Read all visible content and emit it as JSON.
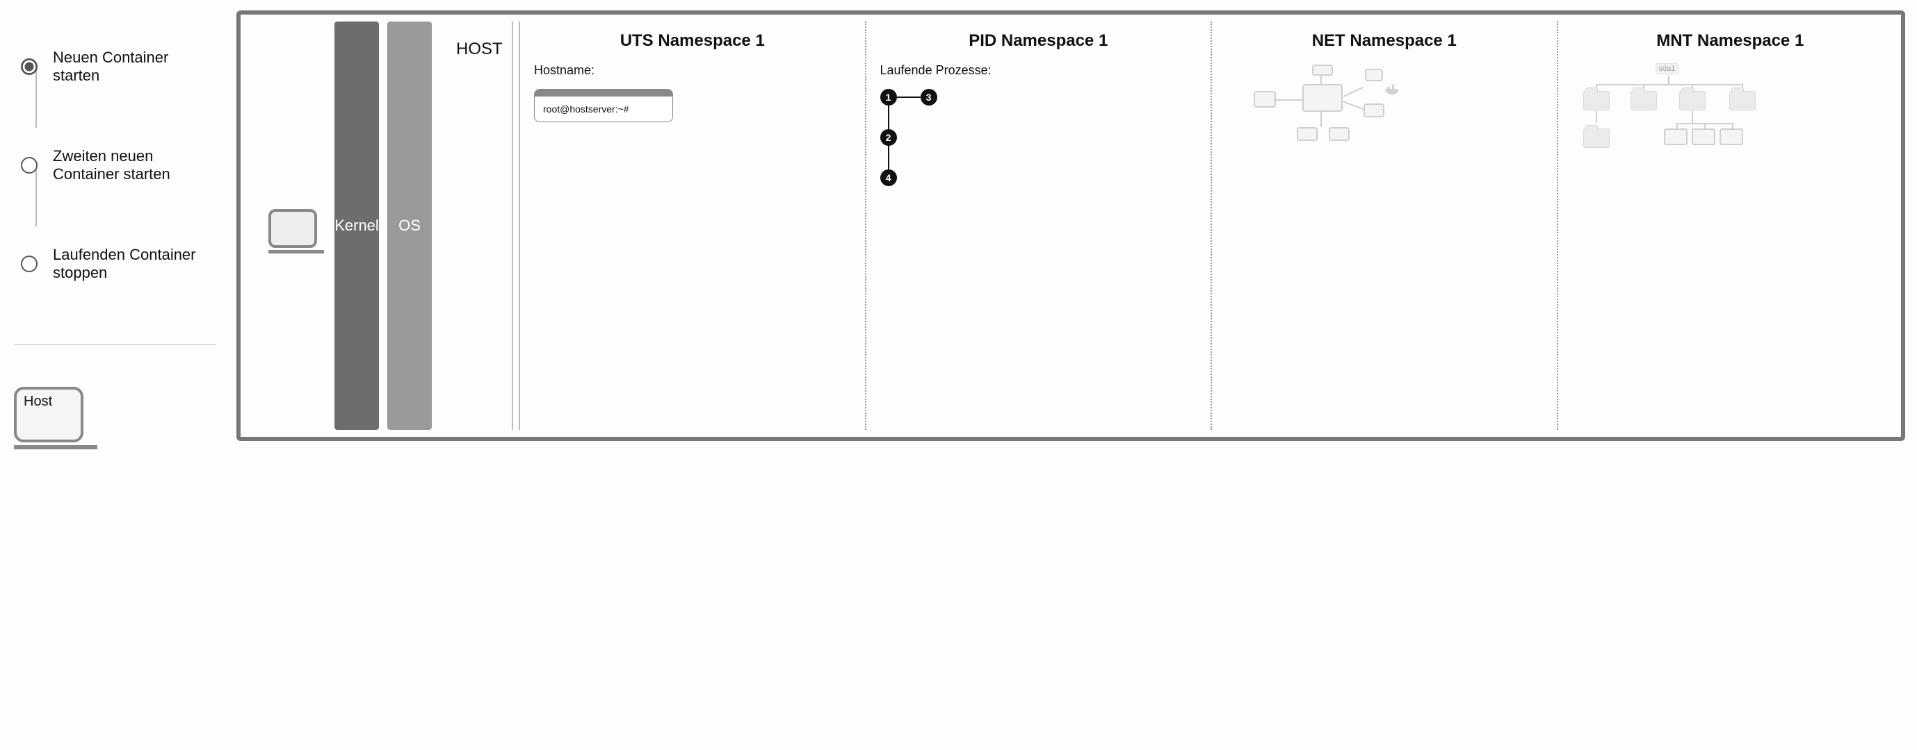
{
  "sidebar": {
    "steps": [
      {
        "label": "Neuen Container starten",
        "active": true
      },
      {
        "label": "Zweiten neuen Container starten",
        "active": false
      },
      {
        "label": "Laufenden Container stoppen",
        "active": false
      }
    ],
    "host_legend_label": "Host"
  },
  "main": {
    "host": {
      "title": "HOST",
      "kernel_label": "Kernel",
      "os_label": "OS"
    },
    "uts": {
      "title": "UTS Namespace 1",
      "subtitle": "Hostname:",
      "terminal_text": "root@hostserver:~#"
    },
    "pid": {
      "title": "PID Namespace 1",
      "subtitle": "Laufende Prozesse:",
      "nodes": [
        "1",
        "2",
        "3",
        "4"
      ]
    },
    "net": {
      "title": "NET Namespace 1"
    },
    "mnt": {
      "title": "MNT Namespace 1",
      "root_label": "sda1"
    }
  }
}
